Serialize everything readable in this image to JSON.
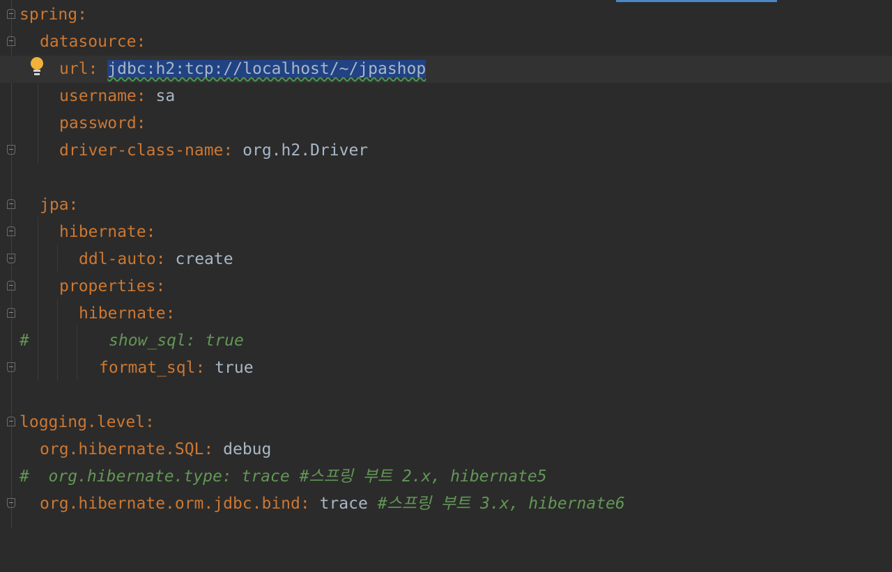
{
  "editor": {
    "colors": {
      "background": "#2b2b2b",
      "key": "#cc7832",
      "value": "#a9b7c6",
      "comment": "#629755",
      "selection": "#214283"
    },
    "lines": [
      {
        "key": "spring",
        "colon": ":",
        "value": ""
      },
      {
        "key": "datasource",
        "colon": ":",
        "value": ""
      },
      {
        "key": "url",
        "colon": ":",
        "value": "jdbc:h2:tcp://localhost/~/jpashop"
      },
      {
        "key": "username",
        "colon": ":",
        "value": "sa"
      },
      {
        "key": "password",
        "colon": ":",
        "value": ""
      },
      {
        "key": "driver-class-name",
        "colon": ":",
        "value": "org.h2.Driver"
      },
      {
        "key": "jpa",
        "colon": ":",
        "value": ""
      },
      {
        "key": "hibernate",
        "colon": ":",
        "value": ""
      },
      {
        "key": "ddl-auto",
        "colon": ":",
        "value": "create"
      },
      {
        "key": "properties",
        "colon": ":",
        "value": ""
      },
      {
        "key": "hibernate",
        "colon": ":",
        "value": ""
      },
      {
        "hash": "#",
        "comment": "show_sql: true"
      },
      {
        "key": "format_sql",
        "colon": ":",
        "value": "true"
      },
      {
        "key": "logging.level",
        "colon": ":",
        "value": ""
      },
      {
        "key": "org.hibernate.SQL",
        "colon": ":",
        "value": "debug"
      },
      {
        "comment": "#  org.hibernate.type: trace #스프링 부트 2.x, hibernate5"
      },
      {
        "key": "org.hibernate.orm.jdbc.bind",
        "colon": ":",
        "value": "trace",
        "comment": " #스프링 부트 3.x, hibernate6"
      }
    ]
  },
  "icons": {
    "intention": "lightbulb-icon",
    "fold": "fold-marker-icon"
  }
}
